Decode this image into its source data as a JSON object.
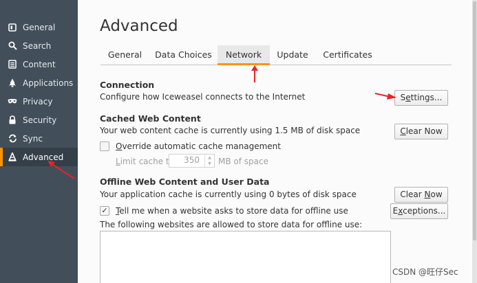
{
  "sidebar": {
    "items": [
      {
        "label": "General",
        "icon": "general-icon"
      },
      {
        "label": "Search",
        "icon": "search-icon"
      },
      {
        "label": "Content",
        "icon": "content-icon"
      },
      {
        "label": "Applications",
        "icon": "applications-icon"
      },
      {
        "label": "Privacy",
        "icon": "privacy-mask-icon"
      },
      {
        "label": "Security",
        "icon": "security-lock-icon"
      },
      {
        "label": "Sync",
        "icon": "sync-icon"
      },
      {
        "label": "Advanced",
        "icon": "advanced-icon",
        "active": true
      }
    ]
  },
  "main": {
    "title": "Advanced",
    "tabs": [
      {
        "label": "General"
      },
      {
        "label": "Data Choices"
      },
      {
        "label": "Network",
        "active": true
      },
      {
        "label": "Update"
      },
      {
        "label": "Certificates"
      }
    ],
    "connection": {
      "title": "Connection",
      "description": "Configure how Iceweasel connects to the Internet",
      "settings_pre": "S",
      "settings_ul": "e",
      "settings_post": "ttings..."
    },
    "cache": {
      "title": "Cached Web Content",
      "description": "Your web content cache is currently using 1.5 MB of disk space",
      "clear_pre": "",
      "clear_ul": "C",
      "clear_post": "lear Now",
      "override_ul": "O",
      "override_post": "verride automatic cache management",
      "override_checked": false,
      "limit_ul": "L",
      "limit_post": "imit cache to",
      "limit_value": "350",
      "limit_unit": "MB of space"
    },
    "offline": {
      "title": "Offline Web Content and User Data",
      "description": "Your application cache is currently using 0 bytes of disk space",
      "clear_pre": "Clear ",
      "clear_ul": "N",
      "clear_post": "ow",
      "tell_ul": "T",
      "tell_post": "ell me when a website asks to store data for offline use",
      "tell_checked": true,
      "exceptions_pre": "E",
      "exceptions_ul": "x",
      "exceptions_post": "ceptions...",
      "list_label": "The following websites are allowed to store data for offline use:"
    }
  },
  "watermark": "CSDN @旺仔Sec",
  "colors": {
    "sidebar_bg": "#424f5a",
    "accent": "#ff9500",
    "annotation_red": "#e8242a"
  }
}
